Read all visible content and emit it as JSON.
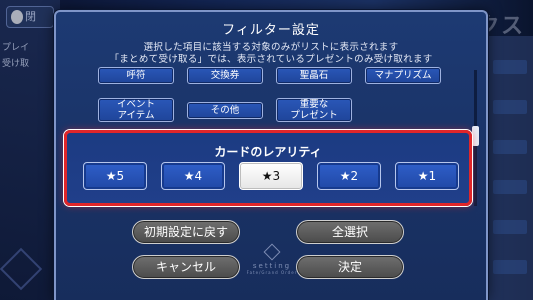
{
  "background": {
    "back_label": "閉",
    "left_labels": [
      "プレイ",
      "受け取"
    ],
    "title_ghost": "プレゼントボックス"
  },
  "dialog": {
    "title": "フィルター設定",
    "subtitle_1": "選択した項目に該当する対象のみがリストに表示されます",
    "subtitle_2": "「まとめて受け取る」では、表示されているプレゼントのみ受け取れます",
    "categories": [
      {
        "label": "呼符"
      },
      {
        "label": "交換券"
      },
      {
        "label": "聖晶石"
      },
      {
        "label": "マナプリズム"
      },
      {
        "label": "イベント\nアイテム"
      },
      {
        "label": "その他"
      },
      {
        "label": "重要な\nプレゼント"
      }
    ],
    "rarity": {
      "label": "カードのレアリティ",
      "options": [
        {
          "label": "★5",
          "selected": false
        },
        {
          "label": "★4",
          "selected": false
        },
        {
          "label": "★3",
          "selected": true
        },
        {
          "label": "★2",
          "selected": false
        },
        {
          "label": "★1",
          "selected": false
        }
      ],
      "highlight_color": "#e0262a"
    },
    "buttons": {
      "reset": "初期設定に戻す",
      "select_all": "全選択",
      "cancel": "キャンセル",
      "confirm": "決定"
    },
    "watermark": {
      "word": "setting",
      "sub": "Fate/Grand Order"
    }
  }
}
